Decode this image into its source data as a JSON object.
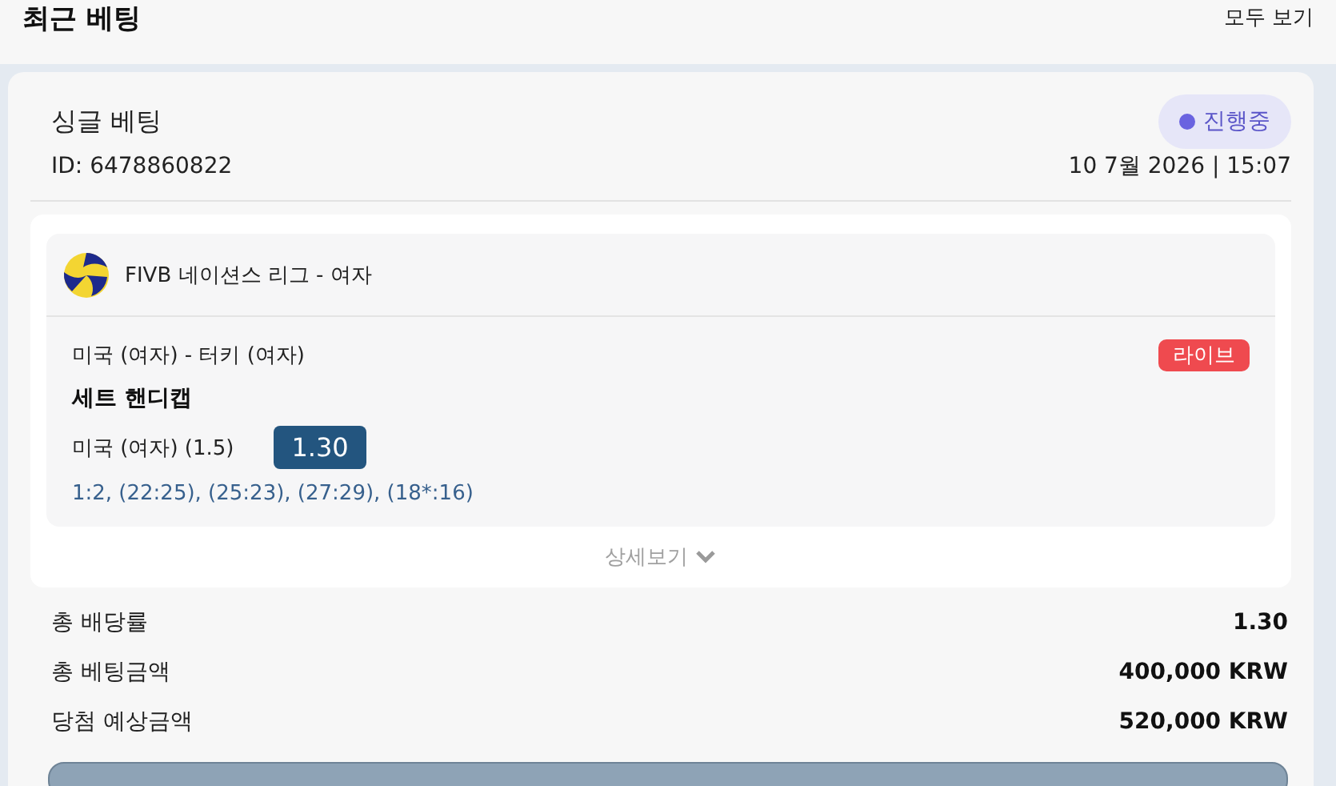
{
  "header": {
    "title": "최근 베팅",
    "link": "모두 보기"
  },
  "bet": {
    "type": "싱글 베팅",
    "id": "ID: 6478860822",
    "status": {
      "label": "진행중",
      "color": "#6a63e0"
    },
    "datetime": "10 7월 2026 | 15:07",
    "league": "FIVB 네이션스 리그 - 여자",
    "match": "미국 (여자) - 터키 (여자)",
    "live": "라이브",
    "market": "세트 핸디캡",
    "selection": "미국 (여자) (1.5)",
    "odds": "1.30",
    "score": "1:2, (22:25), (25:23), (27:29), (18*:16)",
    "details": "상세보기"
  },
  "summary": [
    {
      "label": "총 배당률",
      "value": "1.30"
    },
    {
      "label": "총 베팅금액",
      "value": "400,000 KRW"
    },
    {
      "label": "당첨 예상금액",
      "value": "520,000 KRW"
    }
  ]
}
